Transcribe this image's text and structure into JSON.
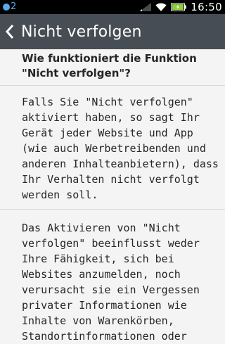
{
  "status_bar": {
    "notification_count": "2",
    "time": "16:50",
    "icons": [
      "notification-icon",
      "signal-icon",
      "wifi-icon",
      "battery-icon"
    ]
  },
  "header": {
    "back_icon": "chevron-left-icon",
    "title": "Nicht verfolgen"
  },
  "main": {
    "question": "Wie funktioniert die Funktion \"Nicht verfolgen\"?",
    "paragraphs": [
      "Falls Sie \"Nicht verfolgen\" aktiviert haben, so sagt Ihr Gerät jeder Website und App (wie auch Werbetreibenden und anderen Inhalteanbietern), dass Ihr Verhalten nicht verfolgt werden soll.",
      "Das Aktivieren von \"Nicht verfolgen\" beeinflusst weder Ihre Fähigkeit, sich bei Websites anzumelden, noch verursacht sie ein Vergessen privater Informationen wie Inhalte von Warenkörben, Standortinformationen oder"
    ]
  },
  "colors": {
    "header_bg": "#474d55",
    "page_bg": "#f4f4f4",
    "status_bar_bg": "#000000",
    "notification_accent": "#5aa9e6",
    "divider": "#d8d8d8"
  }
}
